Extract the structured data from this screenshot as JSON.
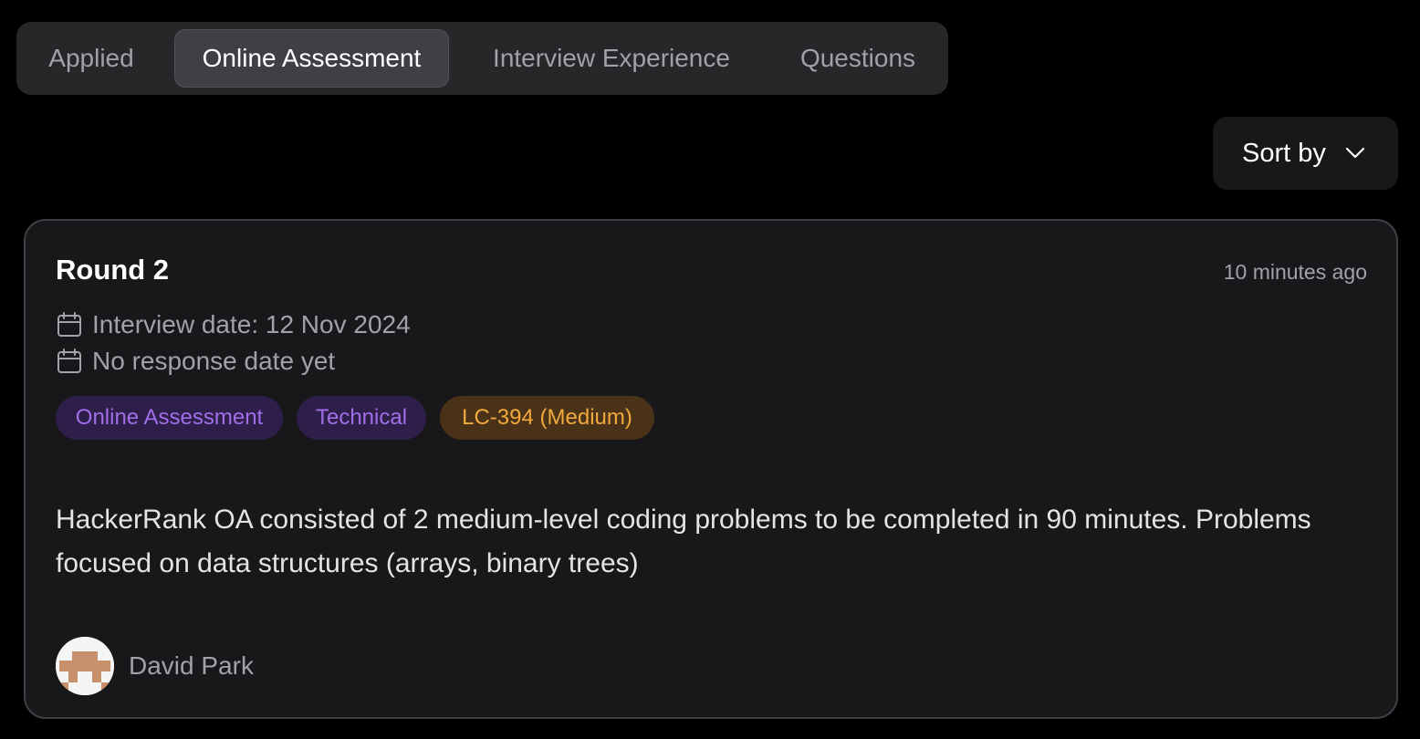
{
  "tabs": [
    {
      "label": "Applied",
      "active": false
    },
    {
      "label": "Online Assessment",
      "active": true
    },
    {
      "label": "Interview Experience",
      "active": false
    },
    {
      "label": "Questions",
      "active": false
    }
  ],
  "sort": {
    "label": "Sort by",
    "icon": "chevron-down-icon"
  },
  "card": {
    "title": "Round 2",
    "time": "10 minutes ago",
    "interview_date": "Interview date: 12 Nov 2024",
    "response_date": "No response date yet",
    "tags": [
      {
        "label": "Online Assessment",
        "color": "#a16ee8",
        "bg": "#2e1f4a"
      },
      {
        "label": "Technical",
        "color": "#a16ee8",
        "bg": "#2e1f4a"
      },
      {
        "label": "LC-394 (Medium)",
        "color": "#f0a93c",
        "bg": "#4a3218"
      }
    ],
    "body": "HackerRank OA consisted of 2 medium-level coding problems to be completed in 90 minutes. Problems focused on data structures (arrays, binary trees)",
    "author": "David Park"
  },
  "colors": {
    "background": "#000000",
    "card": "#18181b",
    "muted_text": "#a1a1aa"
  }
}
